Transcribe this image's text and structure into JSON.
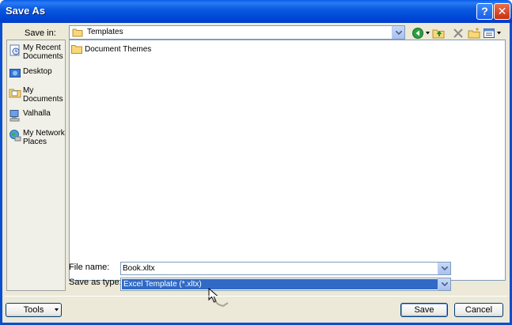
{
  "window": {
    "title": "Save As"
  },
  "title_buttons": {
    "help": "?",
    "close": "✕"
  },
  "save_in": {
    "label": "Save in:",
    "value": "Templates"
  },
  "places": [
    {
      "label": "My Recent Documents",
      "icon": "recent-documents-icon"
    },
    {
      "label": "Desktop",
      "icon": "desktop-icon"
    },
    {
      "label": "My Documents",
      "icon": "my-documents-icon"
    },
    {
      "label": "Valhalla",
      "icon": "computer-icon"
    },
    {
      "label": "My Network Places",
      "icon": "network-places-icon"
    }
  ],
  "files": [
    {
      "name": "Document Themes",
      "icon": "folder-icon"
    }
  ],
  "file_name": {
    "label": "File name:",
    "value": "Book.xltx"
  },
  "save_as_type": {
    "label": "Save as type:",
    "value": "Excel Template (*.xltx)"
  },
  "buttons": {
    "tools": "Tools",
    "save": "Save",
    "cancel": "Cancel"
  },
  "colors": {
    "title_bar": "#0a5ae0",
    "dialog_bg": "#ece9d8",
    "selection": "#316ac5"
  }
}
